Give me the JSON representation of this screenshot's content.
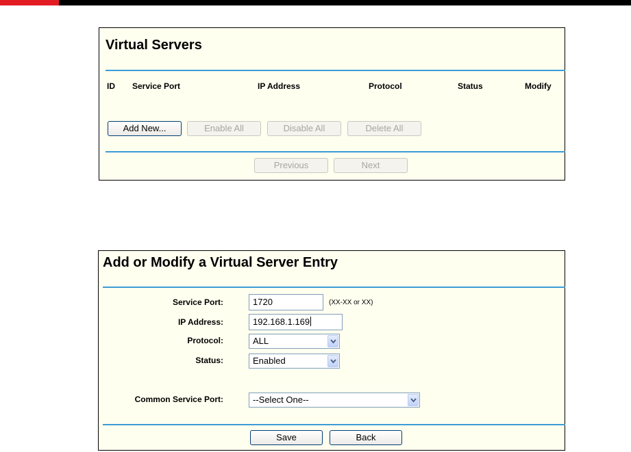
{
  "virtual_servers": {
    "title": "Virtual Servers",
    "columns": [
      "ID",
      "Service Port",
      "IP Address",
      "Protocol",
      "Status",
      "Modify"
    ],
    "buttons": {
      "add_new": "Add New...",
      "enable_all": "Enable All",
      "disable_all": "Disable All",
      "delete_all": "Delete All",
      "previous": "Previous",
      "next": "Next"
    }
  },
  "entry_form": {
    "title": "Add or Modify a Virtual Server Entry",
    "service_port": {
      "label": "Service Port:",
      "value": "1720",
      "hint": "(XX-XX or XX)"
    },
    "ip_address": {
      "label": "IP Address:",
      "value": "192.168.1.169"
    },
    "protocol": {
      "label": "Protocol:",
      "selected": "ALL"
    },
    "status": {
      "label": "Status:",
      "selected": "Enabled"
    },
    "common_service_port": {
      "label": "Common Service Port:",
      "selected": "--Select One--"
    },
    "buttons": {
      "save": "Save",
      "back": "Back"
    }
  },
  "colors": {
    "accent_red": "#e31b23",
    "divider_blue": "#3a9bd6",
    "panel_bg": "#fffff0"
  },
  "icons": {
    "dropdown": "chevron-down-icon"
  }
}
